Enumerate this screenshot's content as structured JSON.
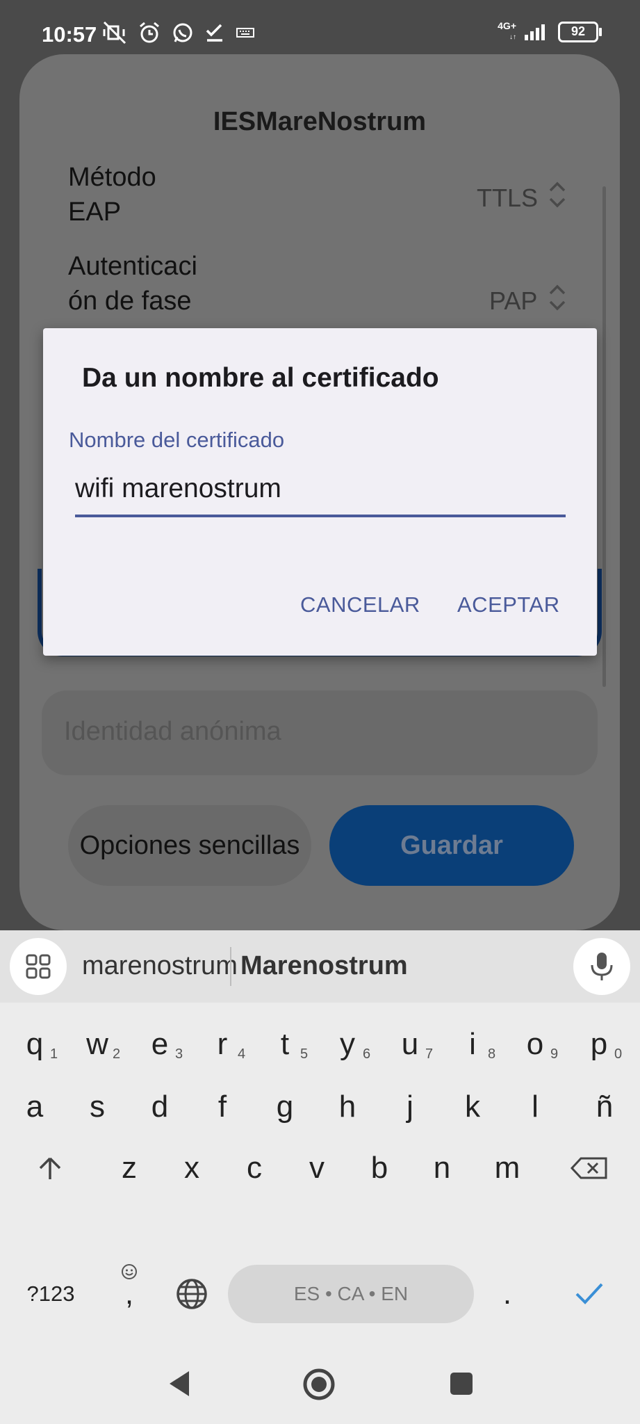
{
  "status_bar": {
    "time": "10:57",
    "network": "4G+",
    "battery": "92"
  },
  "sheet": {
    "title": "IESMareNostrum",
    "eap_label": "Método\nEAP",
    "eap_value": "TTLS",
    "phase2_label": "Autenticaci\nón de fase\n2",
    "phase2_value": "PAP",
    "anon_placeholder": "Identidad anónima",
    "simple_btn": "Opciones sencillas",
    "save_btn": "Guardar"
  },
  "dialog": {
    "title": "Da un nombre al certificado",
    "field_label": "Nombre del certificado",
    "field_value": "wifi marenostrum",
    "cancel": "CANCELAR",
    "accept": "ACEPTAR"
  },
  "keyboard": {
    "suggestions": [
      "marenostrum",
      "Marenostrum"
    ],
    "row1": [
      {
        "k": "q",
        "h": "1"
      },
      {
        "k": "w",
        "h": "2"
      },
      {
        "k": "e",
        "h": "3"
      },
      {
        "k": "r",
        "h": "4"
      },
      {
        "k": "t",
        "h": "5"
      },
      {
        "k": "y",
        "h": "6"
      },
      {
        "k": "u",
        "h": "7"
      },
      {
        "k": "i",
        "h": "8"
      },
      {
        "k": "o",
        "h": "9"
      },
      {
        "k": "p",
        "h": "0"
      }
    ],
    "row2": [
      "a",
      "s",
      "d",
      "f",
      "g",
      "h",
      "j",
      "k",
      "l",
      "ñ"
    ],
    "row3": [
      "z",
      "x",
      "c",
      "v",
      "b",
      "n",
      "m"
    ],
    "symbols": "?123",
    "comma": ",",
    "period": ".",
    "space_label": "ES • CA • EN"
  },
  "icons": {
    "apps": "apps-grid-icon",
    "mic": "microphone-icon",
    "shift": "shift-icon",
    "backspace": "backspace-icon",
    "globe": "globe-icon",
    "enter": "check-icon",
    "emoji": "emoji-icon",
    "nav_back": "back-icon",
    "nav_home": "home-icon",
    "nav_recents": "recents-icon"
  },
  "colors": {
    "accent": "#4a5a9a",
    "save_button": "#0a3f78",
    "check": "#3a8fd6"
  }
}
